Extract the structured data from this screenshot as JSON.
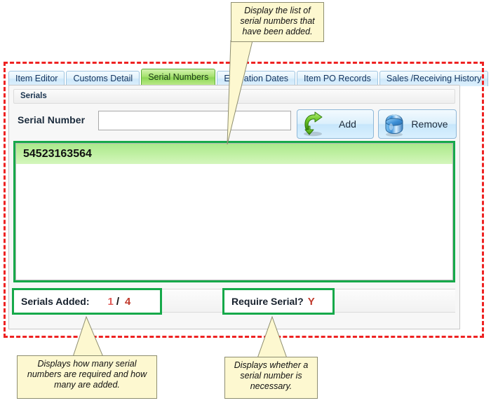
{
  "window": {
    "tabs": [
      {
        "label": "Item Editor",
        "active": false
      },
      {
        "label": "Customs Detail",
        "active": false
      },
      {
        "label": "Serial Numbers",
        "active": true
      },
      {
        "label": "Expiration Dates",
        "active": false
      },
      {
        "label": "Item PO Records",
        "active": false
      },
      {
        "label": "Sales /Receiving History",
        "active": false
      }
    ]
  },
  "panel": {
    "group_title": "Serials",
    "serial_number_label": "Serial Number",
    "serial_number_value": "",
    "serial_number_placeholder": "",
    "add_button_label": "Add",
    "add_button_icon": "green-curved-down-arrow-icon",
    "remove_button_label": "Remove",
    "remove_button_icon": "blue-database-cylinder-icon"
  },
  "serials_list": {
    "items": [
      {
        "serial": "54523163564",
        "selected": true
      }
    ]
  },
  "status": {
    "serials_added_label": "Serials Added:",
    "serials_added_count": "1",
    "serials_added_separator": "/",
    "serials_added_total": "4",
    "require_serial_label": "Require Serial?",
    "require_serial_value": "Y"
  },
  "callouts": {
    "top": "Display the list of serial numbers that have been added.",
    "bottom_left": "Displays how many serial numbers are required and how many are added.",
    "bottom_right": "Displays whether a serial number is necessary."
  },
  "colors": {
    "highlight_red_dashed": "#ee2222",
    "highlight_green_box": "#16a94a",
    "active_tab_green": "#8ed657",
    "tab_blue": "#cfe8fa",
    "callout_yellow": "#fdf8d0",
    "status_value_red": "#c0392b",
    "selected_row_green": "#bff0a2"
  }
}
